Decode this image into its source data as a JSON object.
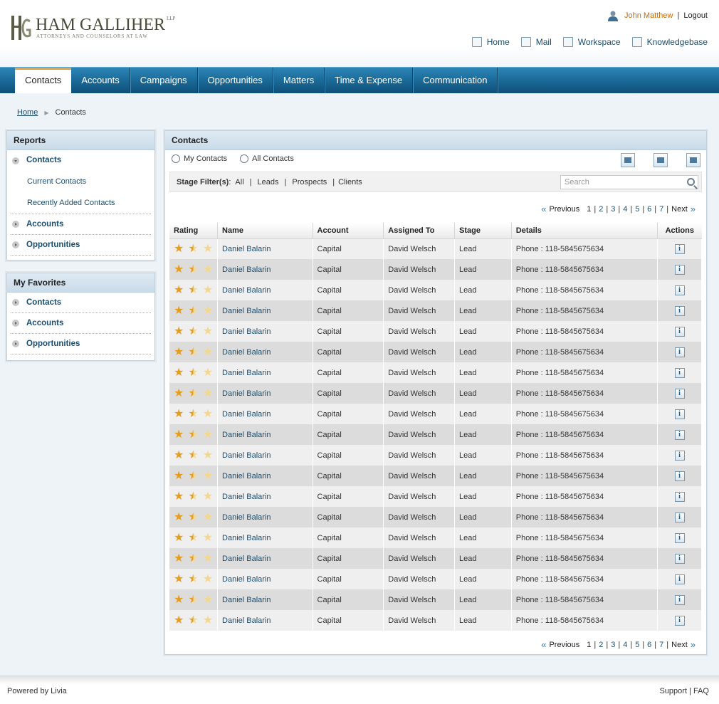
{
  "brand": {
    "name": "HAM GALLIHER",
    "suffix": "LLP",
    "tagline": "ATTORNEYS AND COUNSELORS AT LAW"
  },
  "user": {
    "name": "John Matthew",
    "logout_label": "Logout"
  },
  "top_links": {
    "home": "Home",
    "mail": "Mail",
    "workspace": "Workspace",
    "knowledgebase": "Knowledgebase"
  },
  "nav": {
    "contacts": "Contacts",
    "accounts": "Accounts",
    "campaigns": "Campaigns",
    "opportunities": "Opportunities",
    "matters": "Matters",
    "time_expense": "Time & Expense",
    "communication": "Communication"
  },
  "breadcrumb": {
    "home": "Home",
    "current": "Contacts"
  },
  "reports": {
    "title": "Reports",
    "contacts": "Contacts",
    "current_contacts": "Current Contacts",
    "recently_added": "Recently Added Contacts",
    "accounts": "Accounts",
    "opportunities": "Opportunities"
  },
  "favorites": {
    "title": "My Favorites",
    "contacts": "Contacts",
    "accounts": "Accounts",
    "opportunities": "Opportunities"
  },
  "main": {
    "title": "Contacts",
    "my_contacts": "My Contacts",
    "all_contacts": "All Contacts",
    "stage_filter_label": "Stage Filter(s)",
    "filter_all": "All",
    "filter_leads": "Leads",
    "filter_prospects": "Prospects",
    "filter_clients": "Clients",
    "search_placeholder": "Search"
  },
  "pager": {
    "previous": "Previous",
    "next": "Next",
    "current": "1",
    "pages": [
      "2",
      "3",
      "4",
      "5",
      "6",
      "7"
    ]
  },
  "table": {
    "headers": {
      "rating": "Rating",
      "name": "Name",
      "account": "Account",
      "assigned_to": "Assigned To",
      "stage": "Stage",
      "details": "Details",
      "actions": "Actions"
    },
    "rows": [
      {
        "rating": 1.5,
        "name": "Daniel Balarin",
        "account": "Capital",
        "assigned_to": "David Welsch",
        "stage": "Lead",
        "details": "Phone : 118-5845675634"
      },
      {
        "rating": 1.5,
        "name": "Daniel Balarin",
        "account": "Capital",
        "assigned_to": "David Welsch",
        "stage": "Lead",
        "details": "Phone : 118-5845675634"
      },
      {
        "rating": 1.5,
        "name": "Daniel Balarin",
        "account": "Capital",
        "assigned_to": "David Welsch",
        "stage": "Lead",
        "details": "Phone : 118-5845675634"
      },
      {
        "rating": 1.5,
        "name": "Daniel Balarin",
        "account": "Capital",
        "assigned_to": "David Welsch",
        "stage": "Lead",
        "details": "Phone : 118-5845675634"
      },
      {
        "rating": 1.5,
        "name": "Daniel Balarin",
        "account": "Capital",
        "assigned_to": "David Welsch",
        "stage": "Lead",
        "details": "Phone : 118-5845675634"
      },
      {
        "rating": 1.5,
        "name": "Daniel Balarin",
        "account": "Capital",
        "assigned_to": "David Welsch",
        "stage": "Lead",
        "details": "Phone : 118-5845675634"
      },
      {
        "rating": 1.5,
        "name": "Daniel Balarin",
        "account": "Capital",
        "assigned_to": "David Welsch",
        "stage": "Lead",
        "details": "Phone : 118-5845675634"
      },
      {
        "rating": 1.5,
        "name": "Daniel Balarin",
        "account": "Capital",
        "assigned_to": "David Welsch",
        "stage": "Lead",
        "details": "Phone : 118-5845675634"
      },
      {
        "rating": 1.5,
        "name": "Daniel Balarin",
        "account": "Capital",
        "assigned_to": "David Welsch",
        "stage": "Lead",
        "details": "Phone : 118-5845675634"
      },
      {
        "rating": 1.5,
        "name": "Daniel Balarin",
        "account": "Capital",
        "assigned_to": "David Welsch",
        "stage": "Lead",
        "details": "Phone : 118-5845675634"
      },
      {
        "rating": 1.5,
        "name": "Daniel Balarin",
        "account": "Capital",
        "assigned_to": "David Welsch",
        "stage": "Lead",
        "details": "Phone : 118-5845675634"
      },
      {
        "rating": 1.5,
        "name": "Daniel Balarin",
        "account": "Capital",
        "assigned_to": "David Welsch",
        "stage": "Lead",
        "details": "Phone : 118-5845675634"
      },
      {
        "rating": 1.5,
        "name": "Daniel Balarin",
        "account": "Capital",
        "assigned_to": "David Welsch",
        "stage": "Lead",
        "details": "Phone : 118-5845675634"
      },
      {
        "rating": 1.5,
        "name": "Daniel Balarin",
        "account": "Capital",
        "assigned_to": "David Welsch",
        "stage": "Lead",
        "details": "Phone : 118-5845675634"
      },
      {
        "rating": 1.5,
        "name": "Daniel Balarin",
        "account": "Capital",
        "assigned_to": "David Welsch",
        "stage": "Lead",
        "details": "Phone : 118-5845675634"
      },
      {
        "rating": 1.5,
        "name": "Daniel Balarin",
        "account": "Capital",
        "assigned_to": "David Welsch",
        "stage": "Lead",
        "details": "Phone : 118-5845675634"
      },
      {
        "rating": 1.5,
        "name": "Daniel Balarin",
        "account": "Capital",
        "assigned_to": "David Welsch",
        "stage": "Lead",
        "details": "Phone : 118-5845675634"
      },
      {
        "rating": 1.5,
        "name": "Daniel Balarin",
        "account": "Capital",
        "assigned_to": "David Welsch",
        "stage": "Lead",
        "details": "Phone : 118-5845675634"
      },
      {
        "rating": 1.5,
        "name": "Daniel Balarin",
        "account": "Capital",
        "assigned_to": "David Welsch",
        "stage": "Lead",
        "details": "Phone : 118-5845675634"
      }
    ]
  },
  "footer": {
    "powered_by": "Powered by Livia",
    "support": "Support",
    "faq": "FAQ"
  },
  "colors": {
    "nav_blue": "#1b6a98",
    "accent_orange": "#e8a040",
    "link_blue": "#1a4d6e",
    "star_gold": "#e79d1c"
  }
}
